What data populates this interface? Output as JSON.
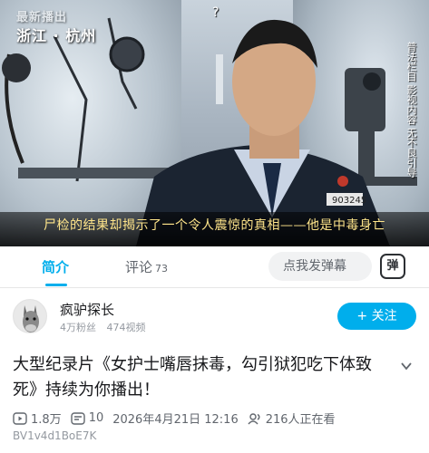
{
  "video": {
    "location_watermark": "最新播出",
    "location": "浙江 · 杭州",
    "side_caption": "普法栏目 影视内容 无不良引导",
    "help_mark": "?",
    "subtitle": "尸检的结果却揭示了一个令人震惊的真相——他是中毒身亡",
    "badge_number": "903245"
  },
  "tabs": [
    {
      "label": "简介",
      "active": true
    },
    {
      "label": "评论",
      "count": "73",
      "active": false
    }
  ],
  "danmaku": {
    "placeholder": "点我发弹幕",
    "toggle_label": "弹"
  },
  "uploader": {
    "name": "疯驴探长",
    "fans": "4万粉丝",
    "videos": "474视频",
    "follow_label": "+ 关注"
  },
  "title": "大型纪录片《女护士嘴唇抹毒，勾引狱犯吃下体致死》持续为你播出！",
  "meta": {
    "views": "1.8万",
    "danmaku_count": "10",
    "datetime": "2026年4月21日 12:16",
    "watching": "216人正在看"
  },
  "bvid": "BV1v4d1BoE7K",
  "colors": {
    "accent": "#00aeec",
    "subtitle": "#ffe58a"
  }
}
